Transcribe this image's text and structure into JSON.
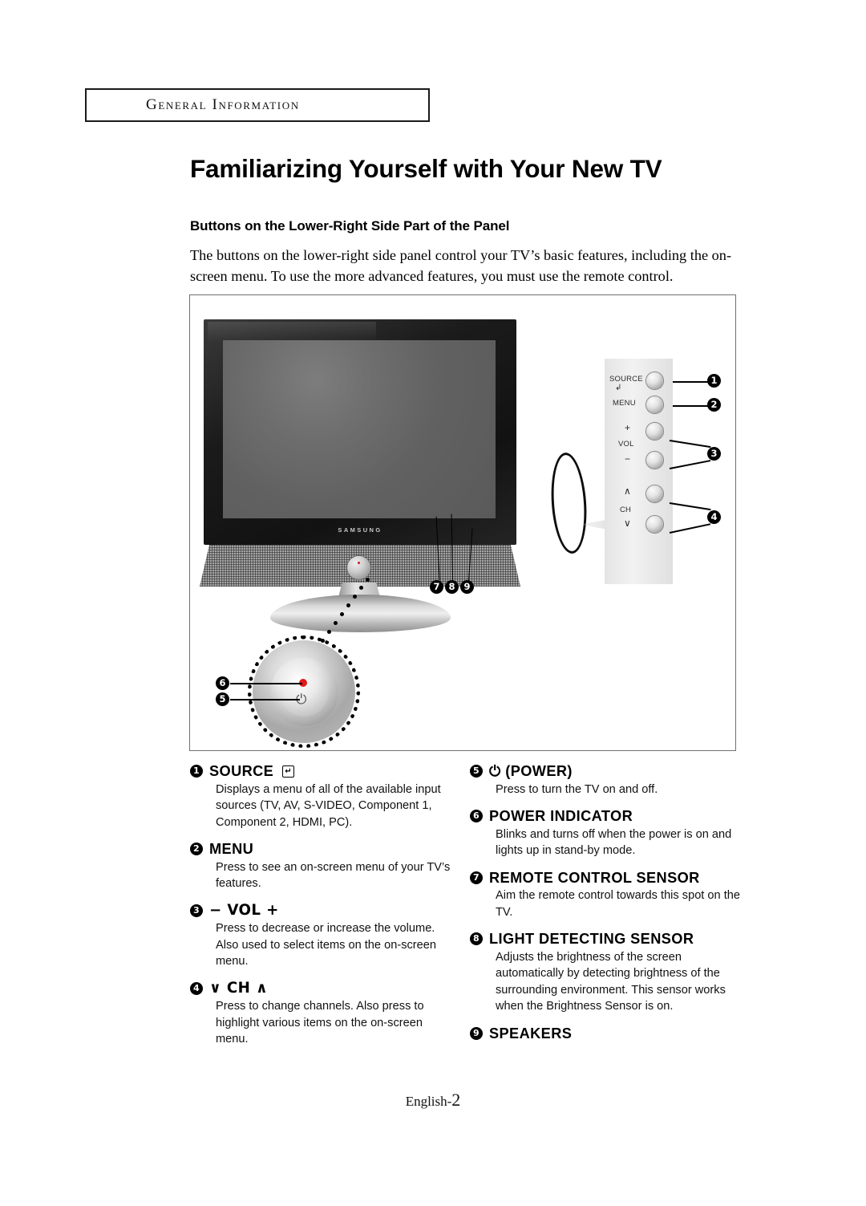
{
  "chapter": {
    "label": "General Information"
  },
  "title": "Familiarizing Yourself with Your New TV",
  "section_title": "Buttons on the Lower-Right Side Part of the Panel",
  "intro": "The buttons on the lower-right side panel control your TV’s basic features, including the on-screen menu. To use the more advanced features, you must use the remote control.",
  "figure": {
    "brand": "SAMSUNG",
    "control_panel": {
      "source_label": "SOURCE",
      "source_icon": "enter-arrow-icon",
      "menu_label": "MENU",
      "vol_label": "VOL",
      "vol_plus": "+",
      "vol_minus": "−",
      "ch_label": "CH",
      "ch_up": "∧",
      "ch_down": "∨"
    },
    "callouts": [
      "1",
      "2",
      "3",
      "4",
      "5",
      "6",
      "7",
      "8",
      "9"
    ],
    "power_detail": {
      "led_callout": "6",
      "power_callout": "5",
      "power_symbol": "⏻"
    }
  },
  "descriptions_left": [
    {
      "num": "1",
      "head": "SOURCE",
      "head_icon": "↵",
      "body": "Displays a menu of all of the available input sources (TV, AV, S-VIDEO, Component 1, Component 2, HDMI, PC)."
    },
    {
      "num": "2",
      "head": "MENU",
      "body": "Press to see an on-screen menu of your TV’s features."
    },
    {
      "num": "3",
      "head": "−  VOL  +",
      "body": "Press to decrease or increase the volume. Also used to select items on the on-screen menu."
    },
    {
      "num": "4",
      "head": "∨  CH  ∧",
      "body": "Press to change channels. Also press to highlight various items on the on-screen menu."
    }
  ],
  "descriptions_right": [
    {
      "num": "5",
      "head": "⏻ (POWER)",
      "body": "Press to turn the TV on and off."
    },
    {
      "num": "6",
      "head": "POWER INDICATOR",
      "body": "Blinks and turns off when the power is on and lights up in stand-by mode."
    },
    {
      "num": "7",
      "head": "REMOTE CONTROL SENSOR",
      "body": "Aim the remote control towards this spot on the TV."
    },
    {
      "num": "8",
      "head": "LIGHT DETECTING SENSOR",
      "body": "Adjusts the brightness of the screen automatically by detecting brightness of the surrounding environment. This sensor works when the Brightness Sensor is on."
    },
    {
      "num": "9",
      "head": "SPEAKERS",
      "body": ""
    }
  ],
  "footer": {
    "lang": "English-",
    "page": "2"
  },
  "colors": {
    "led_red": "#e01b1b",
    "border": "#707070",
    "text": "#000000"
  }
}
